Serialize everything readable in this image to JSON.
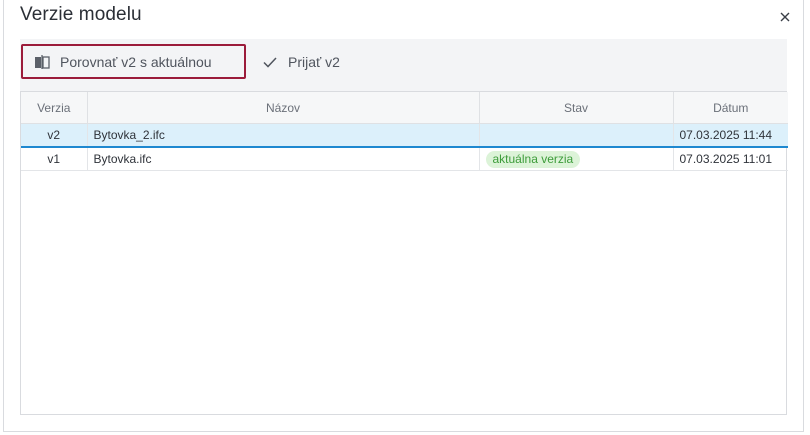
{
  "dialog": {
    "title": "Verzie modelu",
    "close_icon": "close-icon"
  },
  "toolbar": {
    "compare_label": "Porovnať v2 s aktuálnou",
    "compare_icon": "compare-icon",
    "accept_label": "Prijať v2",
    "accept_icon": "checkmark-icon",
    "highlight_color": "#9b1b3a"
  },
  "table": {
    "columns": [
      "Verzia",
      "Názov",
      "Stav",
      "Dátum"
    ],
    "rows": [
      {
        "version": "v2",
        "name": "Bytovka_2.ifc",
        "status": "",
        "date": "07.03.2025 11:44",
        "selected": true
      },
      {
        "version": "v1",
        "name": "Bytovka.ifc",
        "status": "aktuálna verzia",
        "date": "07.03.2025 11:01",
        "selected": false
      }
    ]
  },
  "colors": {
    "selected_row_bg": "#dcf0fb",
    "selected_row_border": "#1e88d0",
    "badge_bg": "#dcf3d8",
    "badge_text": "#3d9c3a"
  }
}
